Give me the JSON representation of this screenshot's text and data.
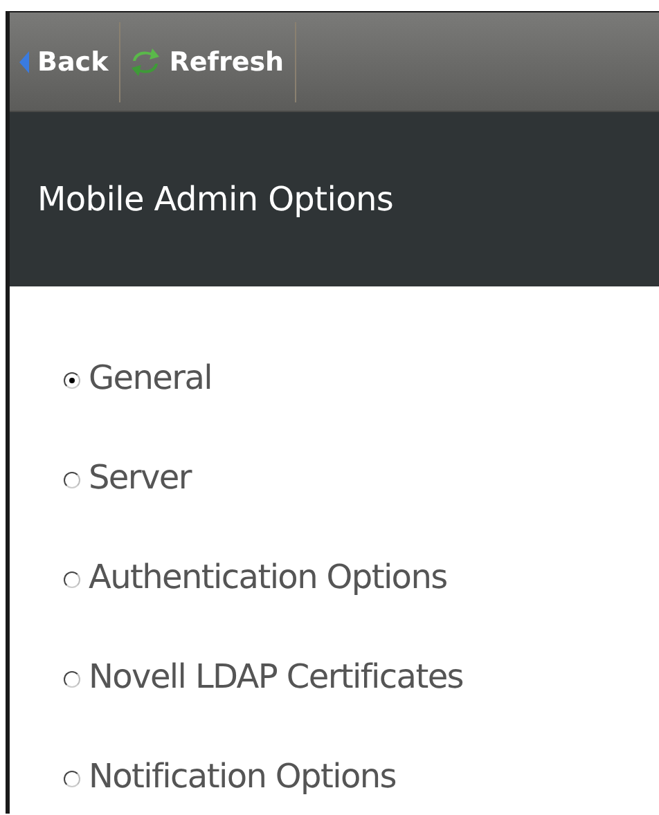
{
  "toolbar": {
    "buttons": [
      {
        "kind": "back",
        "label": "Back"
      },
      {
        "kind": "refresh",
        "label": "Refresh"
      }
    ]
  },
  "header": {
    "title": "Mobile Admin Options"
  },
  "options": [
    {
      "label": "General",
      "selected": true
    },
    {
      "label": "Server",
      "selected": false
    },
    {
      "label": "Authentication Options",
      "selected": false
    },
    {
      "label": "Novell LDAP Certificates",
      "selected": false
    },
    {
      "label": "Notification Options",
      "selected": false
    }
  ]
}
